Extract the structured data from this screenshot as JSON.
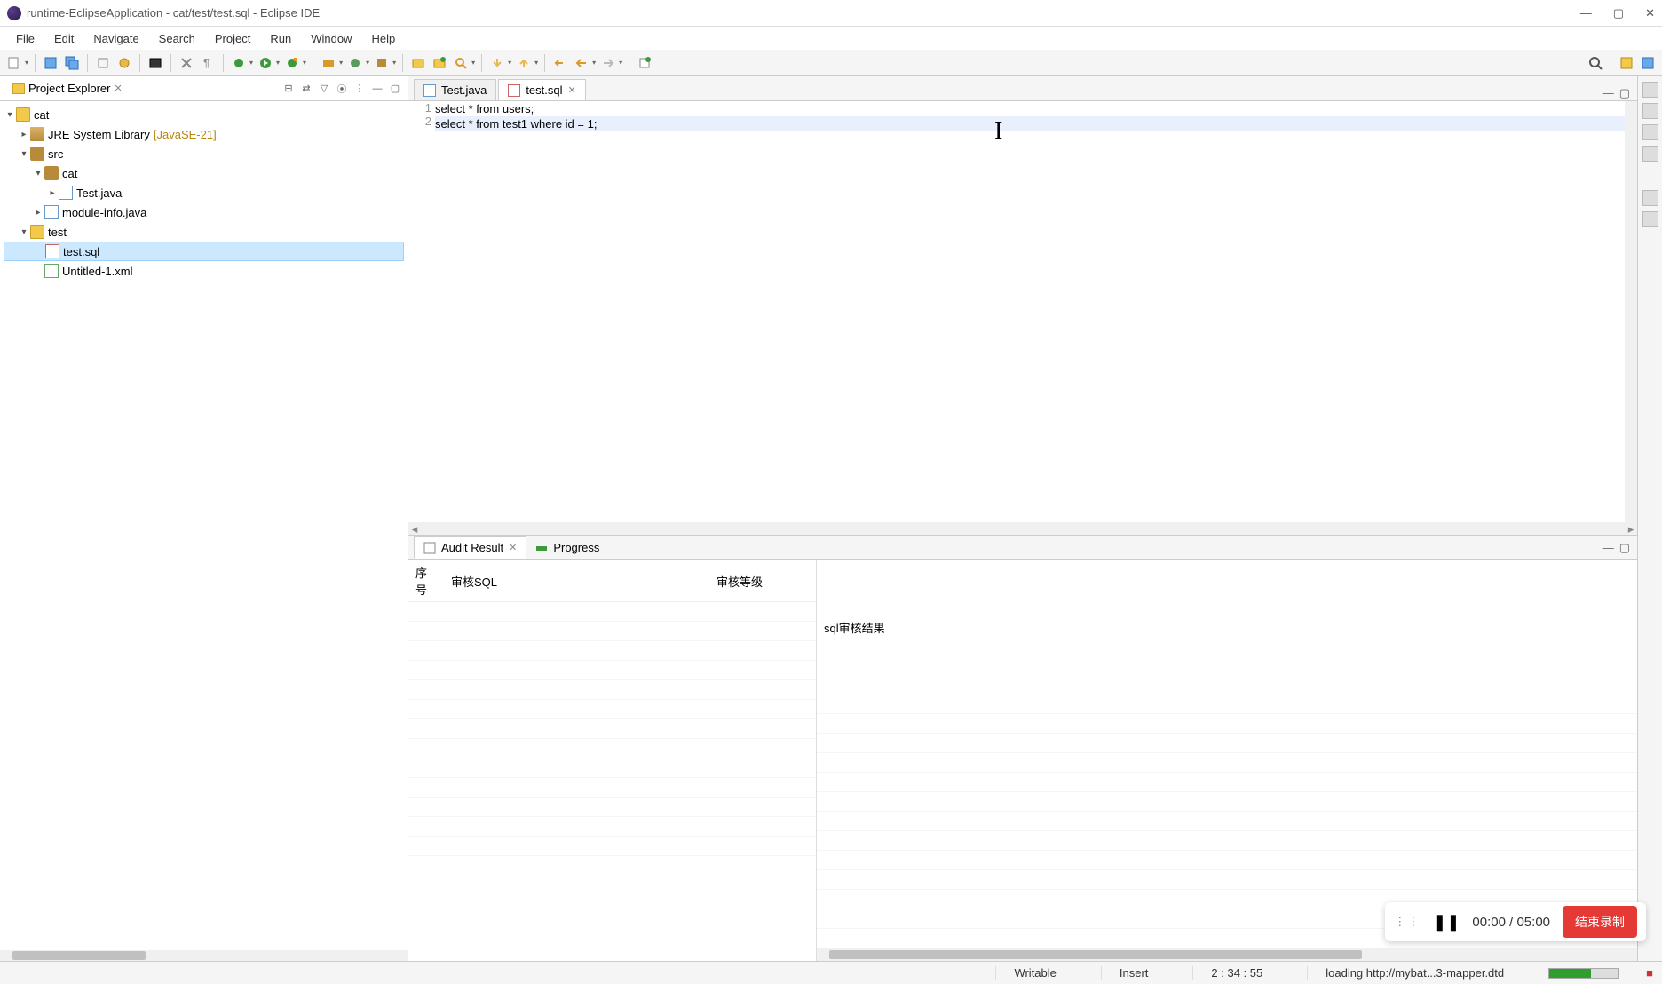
{
  "window": {
    "title": "runtime-EclipseApplication - cat/test/test.sql - Eclipse IDE"
  },
  "menu": {
    "items": [
      "File",
      "Edit",
      "Navigate",
      "Search",
      "Project",
      "Run",
      "Window",
      "Help"
    ]
  },
  "project_explorer": {
    "title": "Project Explorer",
    "tree": {
      "cat": "cat",
      "jre": "JRE System Library",
      "jre_aux": "[JavaSE-21]",
      "src": "src",
      "pkg_cat": "cat",
      "test_java": "Test.java",
      "module_info": "module-info.java",
      "test_folder": "test",
      "test_sql": "test.sql",
      "untitled_xml": "Untitled-1.xml"
    }
  },
  "editor": {
    "tabs": [
      {
        "label": "Test.java"
      },
      {
        "label": "test.sql"
      }
    ],
    "active_tab": 1,
    "lines": [
      "select * from users;",
      "select * from test1 where id = 1;"
    ]
  },
  "bottom": {
    "tabs": [
      {
        "label": "Audit Result"
      },
      {
        "label": "Progress"
      }
    ],
    "active_tab": 0,
    "left_columns": [
      "序号",
      "审核SQL",
      "审核等级"
    ],
    "right_columns": [
      "sql审核结果"
    ]
  },
  "status": {
    "writable": "Writable",
    "insert": "Insert",
    "position": "2 : 34 : 55",
    "loading": "loading http://mybat...3-mapper.dtd"
  },
  "recording": {
    "time": "00:00 / 05:00",
    "stop_label": "结束录制"
  }
}
